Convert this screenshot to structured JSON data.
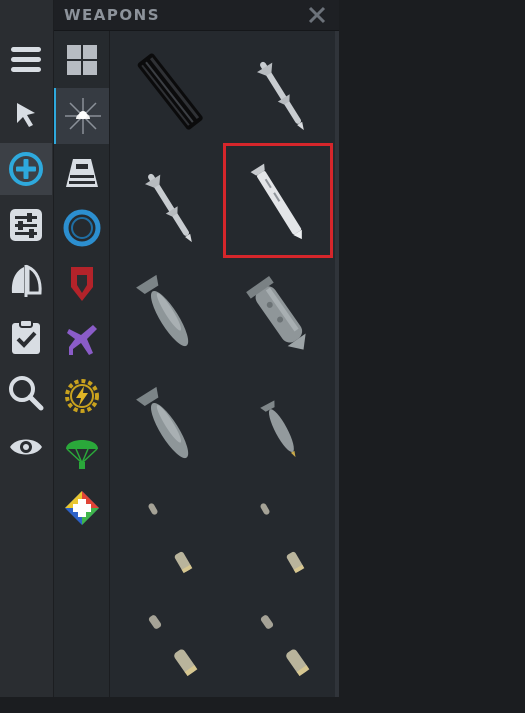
{
  "panel": {
    "title": "WEAPONS"
  },
  "colors": {
    "accent": "#2ea9dd",
    "selection": "#d6262b",
    "menu_icon": "#d8dde3"
  },
  "toolbar": {
    "items": [
      {
        "icon": "hamburger-menu-icon"
      },
      {
        "icon": "pointer-arrow-icon"
      },
      {
        "icon": "add-circle-icon",
        "active": true
      },
      {
        "icon": "sliders-icon"
      },
      {
        "icon": "split-sail-icon"
      },
      {
        "icon": "clipboard-check-icon"
      },
      {
        "icon": "magnifier-icon"
      },
      {
        "icon": "eye-icon"
      }
    ]
  },
  "categories": [
    {
      "icon": "grid-all-icon"
    },
    {
      "icon": "weapons-starburst-icon",
      "active": true
    },
    {
      "icon": "capsule-icon"
    },
    {
      "icon": "blue-ring-icon"
    },
    {
      "icon": "red-shield-icon"
    },
    {
      "icon": "purple-aircraft-icon"
    },
    {
      "icon": "lightning-gear-icon"
    },
    {
      "icon": "parachute-icon"
    },
    {
      "icon": "colored-compass-plus-icon"
    }
  ],
  "weapons": [
    {
      "icon": "rocket-pod-icon"
    },
    {
      "icon": "missile-icon"
    },
    {
      "icon": "missile-icon"
    },
    {
      "icon": "glide-bomb-icon",
      "selected": true
    },
    {
      "icon": "bomb-icon"
    },
    {
      "icon": "cluster-bomb-icon"
    },
    {
      "icon": "bomb-icon"
    },
    {
      "icon": "small-bomb-icon"
    },
    {
      "icon": "shell-pair-icon"
    },
    {
      "icon": "shell-pair-icon"
    },
    {
      "icon": "shell-pair-icon"
    },
    {
      "icon": "shell-pair-icon"
    }
  ]
}
